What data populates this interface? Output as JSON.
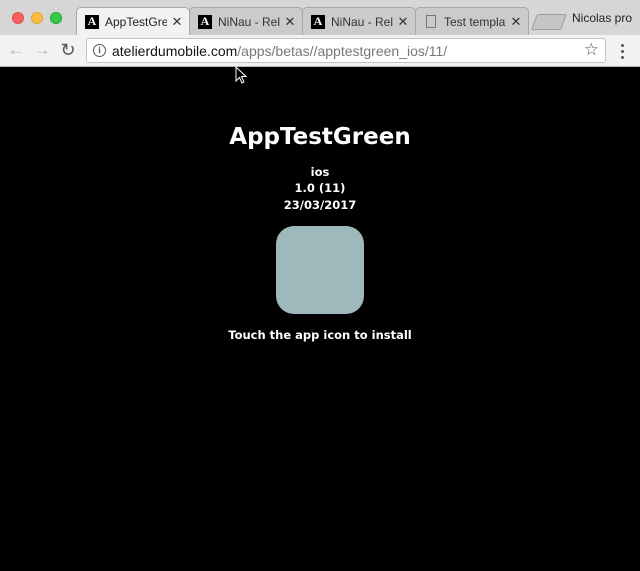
{
  "browser": {
    "tabs": [
      {
        "title": "AppTestGreen",
        "favicon": "A",
        "active": true
      },
      {
        "title": "NiNau - Rele",
        "favicon": "A",
        "active": false
      },
      {
        "title": "NiNau - Rele",
        "favicon": "A",
        "active": false
      },
      {
        "title": "Test templat",
        "favicon": "document-icon",
        "active": false
      }
    ],
    "close_glyph": "✕",
    "profile_name": "Nicolas pro",
    "address": {
      "host": "atelierdumobile.com",
      "path": "/apps/betas//apptestgreen_ios/11/"
    }
  },
  "page": {
    "app_name": "AppTestGreen",
    "platform": "ios",
    "version": "1.0 (11)",
    "date": "23/03/2017",
    "icon_color": "#9fb8bb",
    "install_hint": "Touch the app icon to install"
  }
}
